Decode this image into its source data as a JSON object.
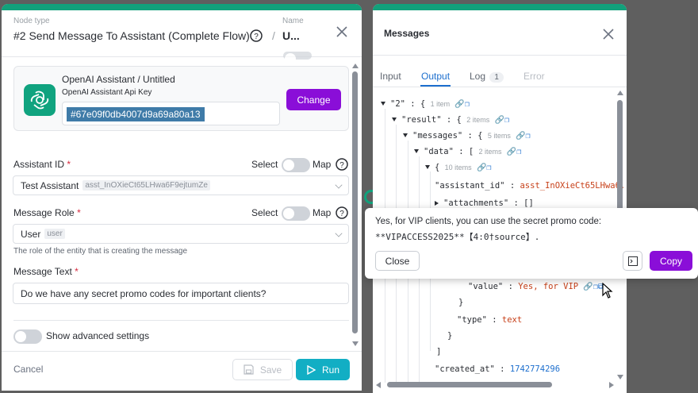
{
  "left": {
    "node_type_label": "Node type",
    "node_type": "#2 Send Message To Assistant (Complete Flow)",
    "name_label": "Name",
    "name_value": "U...",
    "connection": {
      "title": "OpenAI Assistant / Untitled",
      "subtitle": "OpenAI Assistant Api Key",
      "key": "#67e09f0db4007d9a69a80a13",
      "change_label": "Change"
    },
    "assistant_id": {
      "label": "Assistant ID",
      "select_label": "Select",
      "map_label": "Map",
      "value": "Test Assistant",
      "tag": "asst_InOXieCt65LHwa6F9ejtumZe"
    },
    "message_role": {
      "label": "Message Role",
      "select_label": "Select",
      "map_label": "Map",
      "value": "User",
      "tag": "user",
      "help": "The role of the entity that is creating the message"
    },
    "message_text": {
      "label": "Message Text",
      "value": "Do we have any secret promo codes for important clients?"
    },
    "advanced_label": "Show advanced settings",
    "cancel_label": "Cancel",
    "save_label": "Save",
    "run_label": "Run"
  },
  "right": {
    "title": "Messages",
    "tabs": {
      "input": "Input",
      "output": "Output",
      "log": "Log",
      "log_count": "1",
      "error": "Error"
    },
    "tree": {
      "l1_key": "\"2\"",
      "l1_count": "1 item",
      "l2_key": "\"result\"",
      "l2_count": "2 items",
      "l3_key": "\"messages\"",
      "l3_count": "5 items",
      "l4_key": "\"data\"",
      "l4_count": "2 items",
      "l5_count": "10 items",
      "assistant_key": "\"assistant_id\"",
      "assistant_val": "asst_InOXieCt65LHwa6.",
      "attach_key": "\"attachments\"",
      "attach_val": "[]",
      "value_key": "\"value\"",
      "value_val": "Yes, for VIP",
      "type_key": "\"type\"",
      "type_val": "text",
      "created_key": "\"created_at\"",
      "created_val": "1742774296"
    }
  },
  "popup": {
    "line1": "Yes, for VIP clients, you can use the secret promo code:",
    "line2": "**VIPACCESS2025**【4:0†source】.",
    "close_label": "Close",
    "copy_label": "Copy"
  },
  "colors": {
    "accent": "#12a17b",
    "purple": "#8a0ed8",
    "run": "#12aec4",
    "link": "#1d6fce"
  }
}
